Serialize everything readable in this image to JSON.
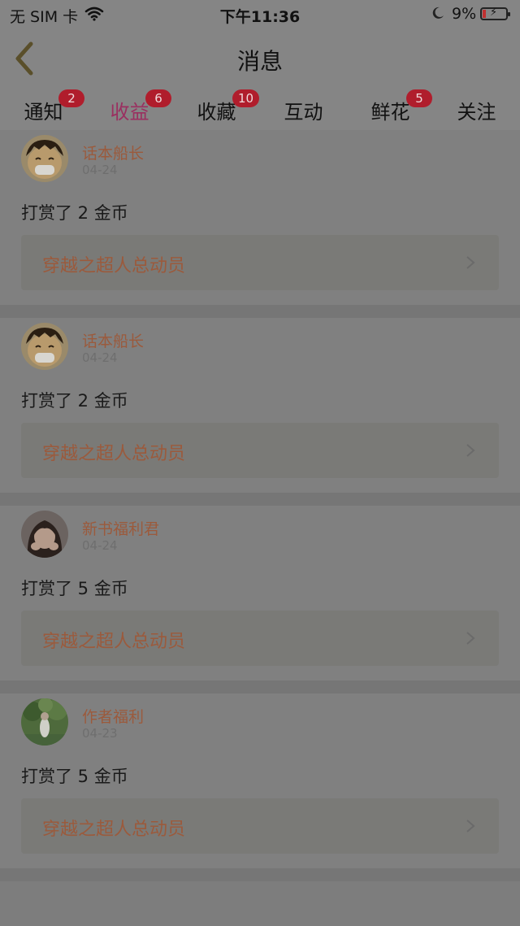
{
  "status_bar": {
    "carrier": "无 SIM 卡",
    "time": "下午11:36",
    "battery": "9%"
  },
  "header": {
    "title": "消息"
  },
  "tabs": [
    {
      "label": "通知",
      "badge": "2"
    },
    {
      "label": "收益",
      "badge": "6",
      "active": true
    },
    {
      "label": "收藏",
      "badge": "10"
    },
    {
      "label": "互动",
      "badge": ""
    },
    {
      "label": "鲜花",
      "badge": "5"
    },
    {
      "label": "关注",
      "badge": ""
    }
  ],
  "items": [
    {
      "author": "话本船长",
      "date": "04-24",
      "message": "打赏了 2 金币",
      "book": "穿越之超人总动员",
      "avatar": "cartoon-avatar"
    },
    {
      "author": "话本船长",
      "date": "04-24",
      "message": "打赏了 2 金币",
      "book": "穿越之超人总动员",
      "avatar": "cartoon-avatar"
    },
    {
      "author": "新书福利君",
      "date": "04-24",
      "message": "打赏了 5 金币",
      "book": "穿越之超人总动员",
      "avatar": "girl-photo-avatar"
    },
    {
      "author": "作者福利",
      "date": "04-23",
      "message": "打赏了 5 金币",
      "book": "穿越之超人总动员",
      "avatar": "nature-photo-avatar"
    }
  ],
  "colors": {
    "accent": "#9a2f60",
    "badge": "#b01d2c",
    "author": "#9b5a3c"
  }
}
